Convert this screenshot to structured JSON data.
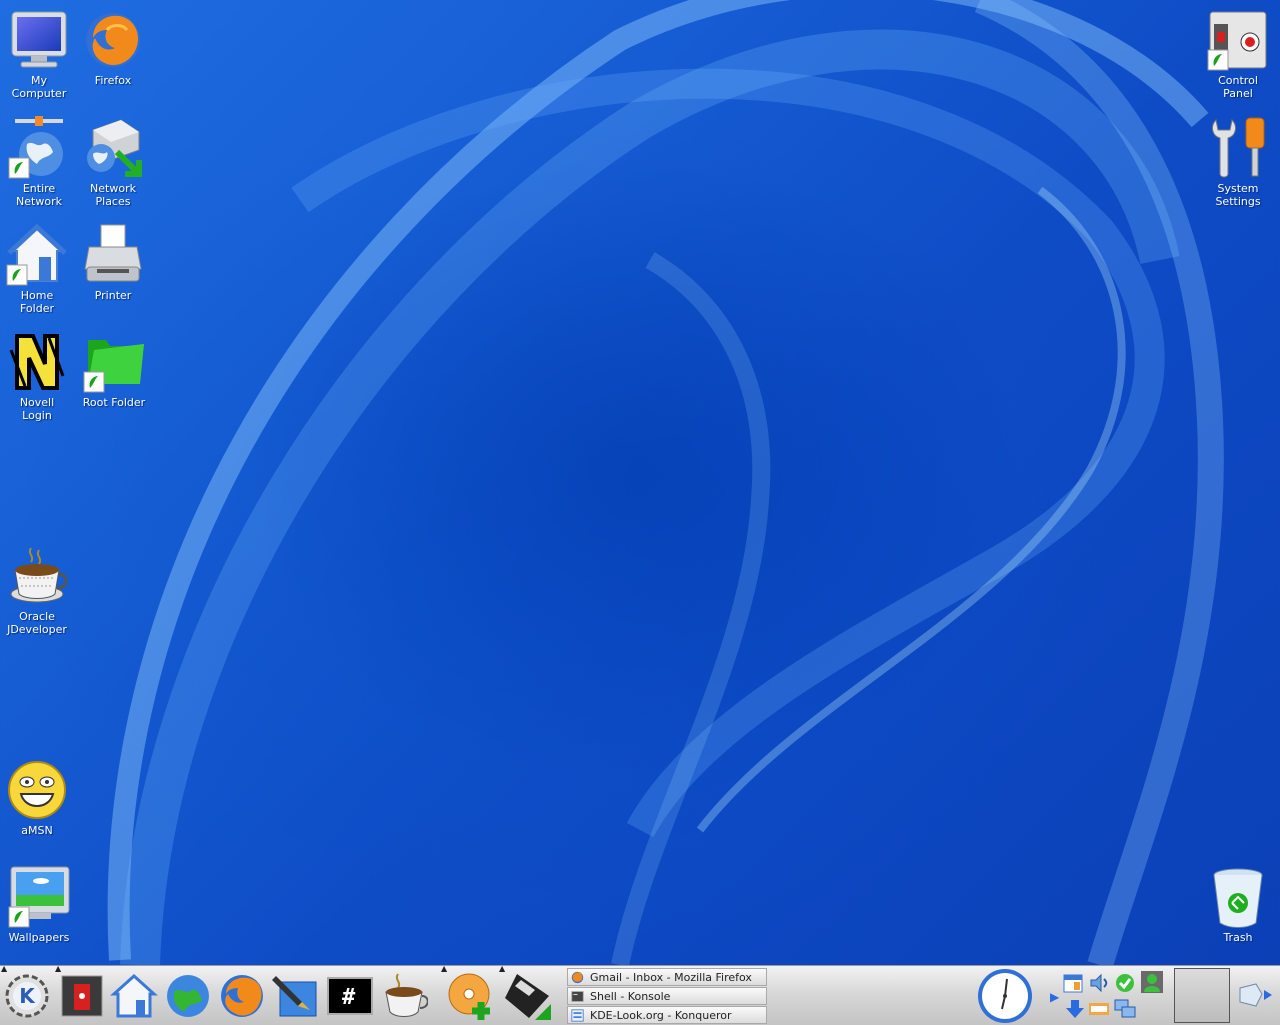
{
  "desktop": {
    "icons": [
      {
        "label": "My\nComputer",
        "icon": "computer-icon"
      },
      {
        "label": "Firefox",
        "icon": "firefox-icon"
      },
      {
        "label": "Entire\nNetwork",
        "icon": "network-globe-icon"
      },
      {
        "label": "Network\nPlaces",
        "icon": "network-places-icon"
      },
      {
        "label": "Home\nFolder",
        "icon": "home-folder-icon"
      },
      {
        "label": "Printer",
        "icon": "printer-icon"
      },
      {
        "label": "Novell\nLogin",
        "icon": "novell-icon"
      },
      {
        "label": "Root Folder",
        "icon": "green-folder-icon"
      },
      {
        "label": "Oracle\nJDeveloper",
        "icon": "coffee-cup-icon"
      },
      {
        "label": "aMSN",
        "icon": "smiley-icon"
      },
      {
        "label": "Wallpapers",
        "icon": "wallpaper-monitor-icon"
      },
      {
        "label": "Control\nPanel",
        "icon": "control-panel-icon"
      },
      {
        "label": "System\nSettings",
        "icon": "tools-icon"
      },
      {
        "label": "Trash",
        "icon": "trash-icon"
      }
    ]
  },
  "taskbar": {
    "launchers": [
      "kde-menu-icon",
      "logout-icon",
      "home-icon",
      "konqueror-globe-icon",
      "firefox-icon",
      "editor-pen-icon",
      "terminal-icon",
      "jdeveloper-icon",
      "cd-burner-icon",
      "floppy-icon"
    ],
    "tasks": [
      {
        "title": "Gmail - Inbox - Mozilla Firefox",
        "icon": "firefox-icon"
      },
      {
        "title": "Shell - Konsole",
        "icon": "konsole-icon"
      },
      {
        "title": "KDE-Look.org - Konqueror",
        "icon": "kde-look-icon"
      }
    ],
    "clock": "clock-icon",
    "tray_icons": [
      "calendar-icon",
      "speaker-icon",
      "check-icon",
      "user-icon",
      "download-icon",
      "network-status-icon",
      "display-icon"
    ],
    "terminal_glyph": "#",
    "kde_glyph": "K"
  },
  "colors": {
    "desktop_blue": "#1660d4",
    "taskbar_grey": "#d4d4d4"
  }
}
